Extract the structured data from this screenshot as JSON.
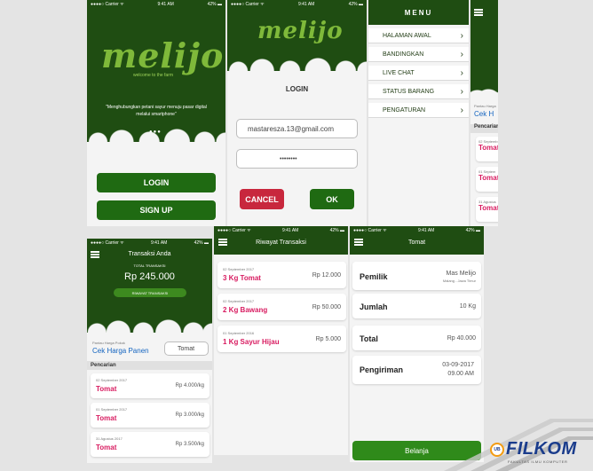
{
  "splash": {
    "status": {
      "carrier": "●●●●○ Carrier ᯤ",
      "time": "9:41 AM",
      "battery": "42% ▬"
    },
    "logo": "melijo",
    "tagline": "welcome to the farm",
    "quote": "\"Menghubungkan petani sayur menuju pasar digital melalui smartphone\"",
    "login_label": "LOGIN",
    "signup_label": "SIGN UP"
  },
  "login": {
    "status": {
      "carrier": "●●●●○ Carrier ᯤ",
      "time": "9:41 AM",
      "battery": "42% ▬"
    },
    "logo": "melijo",
    "title": "LOGIN",
    "email_value": "mastaresza.13@gmail.com",
    "password_value": "••••••••",
    "cancel_label": "CANCEL",
    "ok_label": "OK"
  },
  "menu": {
    "title": "MENU",
    "items": [
      "HALAMAN AWAL",
      "BANDINGKAN",
      "LIVE CHAT",
      "STATUS BARANG",
      "PENGATURAN"
    ]
  },
  "peek": {
    "label": "Pantau Harga",
    "link": "Cek H",
    "section": "Pencarian",
    "items": [
      {
        "date": "02 Septemb",
        "name": "Tomat"
      },
      {
        "date": "01 Septem",
        "name": "Tomat"
      },
      {
        "date": "31 Agustus",
        "name": "Tomat"
      }
    ]
  },
  "transaksi": {
    "status": {
      "carrier": "●●●●○ Carrier ᯤ",
      "time": "9:41 AM",
      "battery": "42% ▬"
    },
    "title": "Transaksi Anda",
    "total_label": "TOTAL TRANSAKSI",
    "total_value": "Rp 245.000",
    "button_label": "RIWAYAT TRANSAKSI",
    "monitor_label": "Pantau Harga Pokok",
    "link": "Cek Harga Panen",
    "search_value": "Tomat",
    "section": "Pencarian",
    "items": [
      {
        "date": "02 September 2017",
        "name": "Tomat",
        "price": "Rp 4.000/kg"
      },
      {
        "date": "01 September 2017",
        "name": "Tomat",
        "price": "Rp 3.000/kg"
      },
      {
        "date": "31 Agustus 2017",
        "name": "Tomat",
        "price": "Rp 3.500/kg"
      }
    ]
  },
  "riwayat": {
    "status": {
      "carrier": "●●●●○ Carrier ᯤ",
      "time": "9:41 AM",
      "battery": "42% ▬"
    },
    "title": "Riwayat Transaksi",
    "items": [
      {
        "date": "02 September 2017",
        "name": "3 Kg Tomat",
        "price": "Rp 12.000"
      },
      {
        "date": "02 September 2017",
        "name": "2 Kg Bawang",
        "price": "Rp 50.000"
      },
      {
        "date": "01 September 2016",
        "name": "1 Kg Sayur Hijau",
        "price": "Rp 5.000"
      }
    ]
  },
  "detail": {
    "status": {
      "carrier": "●●●●○ Carrier ᯤ",
      "time": "9:41 AM",
      "battery": "42% ▬"
    },
    "title": "Tomat",
    "pemilik_label": "Pemilik",
    "pemilik_value": "Mas Melijo",
    "pemilik_sub": "Malang - Jawa Timur",
    "jumlah_label": "Jumlah",
    "jumlah_value": "10 Kg",
    "total_label": "Total",
    "total_value": "Rp 40.000",
    "kirim_label": "Pengiriman",
    "kirim_date": "03-09-2017",
    "kirim_time": "09.00 AM",
    "button_label": "Belanja"
  },
  "watermark": {
    "brand": "FILKOM",
    "prefix": "UB",
    "sub": "FAKULTAS ILMU KOMPUTER"
  }
}
